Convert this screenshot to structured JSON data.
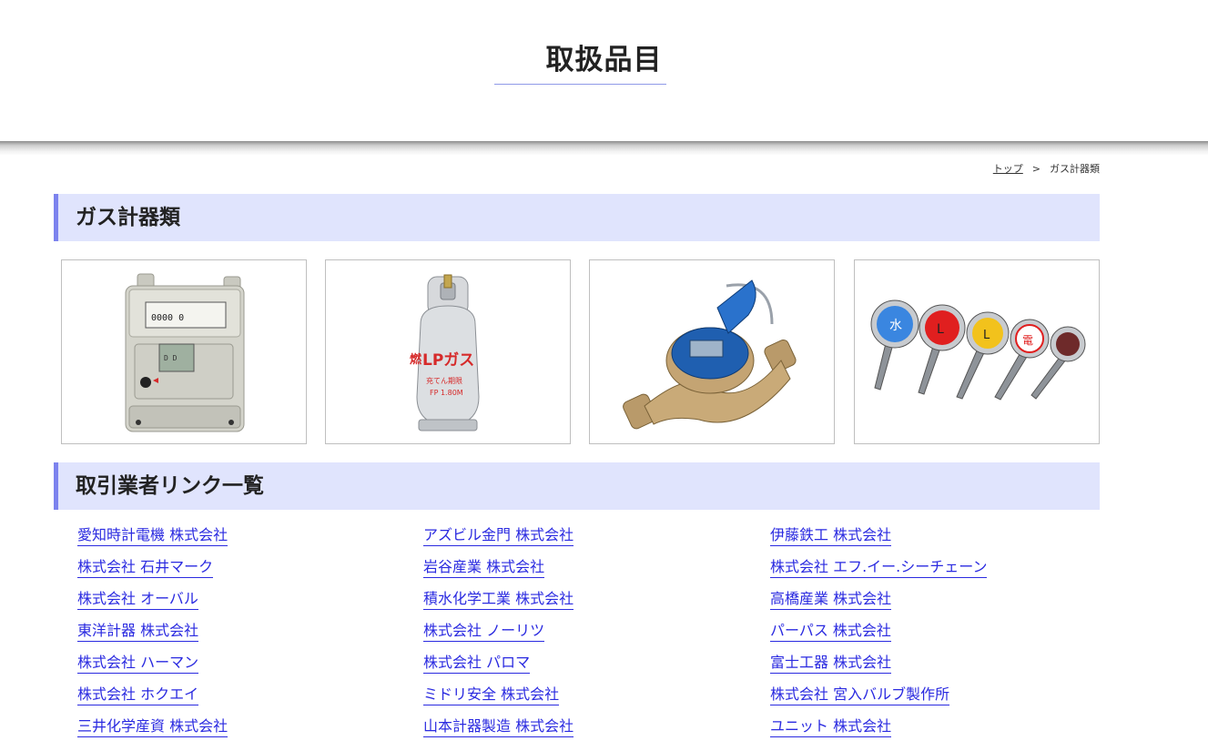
{
  "header": {
    "title": "取扱品目"
  },
  "breadcrumb": {
    "home": "トップ",
    "separator": ">",
    "current": "ガス計器類"
  },
  "sections": {
    "products_title": "ガス計器類",
    "links_title": "取引業者リンク一覧"
  },
  "products": [
    {
      "name": "gas-meter",
      "panel_text": "D D"
    },
    {
      "name": "lp-gas-cylinder",
      "label_kanji": "燃",
      "label_main": "LPガス",
      "label_sub1": "充てん期限",
      "label_sub2": "FP 1.80M"
    },
    {
      "name": "water-meter"
    },
    {
      "name": "marker-pins",
      "pin_labels": [
        "水",
        "L",
        "L",
        "電",
        ""
      ]
    }
  ],
  "vendors": [
    "愛知時計電機 株式会社",
    "アズビル金門 株式会社",
    "伊藤鉄工 株式会社",
    "株式会社 石井マーク",
    "岩谷産業 株式会社",
    "株式会社 エフ.イー.シーチェーン",
    "株式会社 オーバル",
    "積水化学工業 株式会社",
    "高橋産業 株式会社",
    "東洋計器 株式会社",
    "株式会社 ノーリツ",
    "パーパス 株式会社",
    "株式会社 ハーマン",
    "株式会社 パロマ",
    "富士工器 株式会社",
    "株式会社 ホクエイ",
    "ミドリ安全 株式会社",
    "株式会社 宮入バルブ製作所",
    "三井化学産資 株式会社",
    "山本計器製造 株式会社",
    "ユニット 株式会社"
  ],
  "colors": {
    "section_bg": "#e0e4fd",
    "section_accent": "#7c83ee",
    "link": "#2a2ae0",
    "title_rule": "#8f9ae8"
  }
}
